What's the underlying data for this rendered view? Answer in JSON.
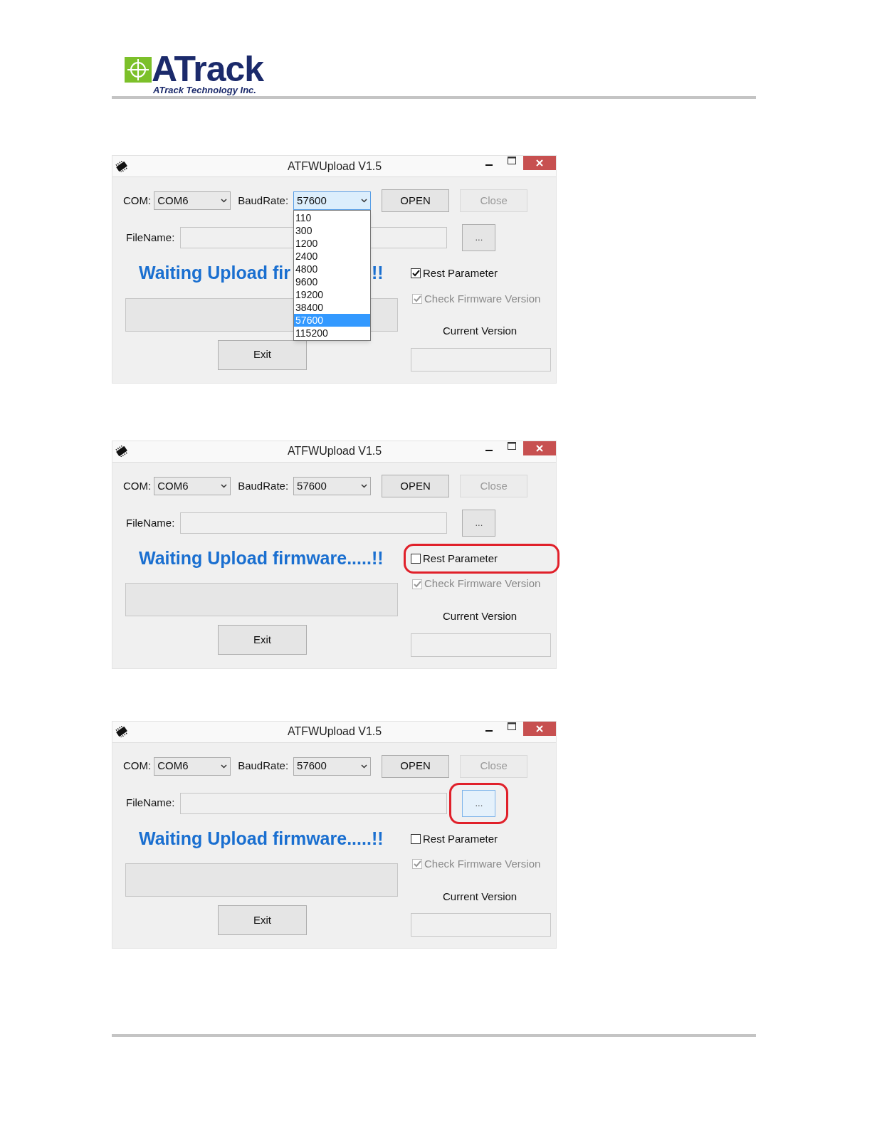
{
  "header": {
    "logo_name": "ATrack",
    "logo_tagline": "ATrack Technology Inc."
  },
  "windows": [
    {
      "title": "ATFWUpload V1.5",
      "com_label": "COM:",
      "com_value": "COM6",
      "baud_label": "BaudRate:",
      "baud_value": "57600",
      "baud_open": true,
      "baud_options": [
        {
          "label": "110",
          "selected": false
        },
        {
          "label": "300",
          "selected": false
        },
        {
          "label": "1200",
          "selected": false
        },
        {
          "label": "2400",
          "selected": false
        },
        {
          "label": "4800",
          "selected": false
        },
        {
          "label": "9600",
          "selected": false
        },
        {
          "label": "19200",
          "selected": false
        },
        {
          "label": "38400",
          "selected": false
        },
        {
          "label": "57600",
          "selected": true
        },
        {
          "label": "115200",
          "selected": false
        }
      ],
      "open_button": "OPEN",
      "close_button": {
        "label": "Close",
        "disabled": true
      },
      "filename_label": "FileName:",
      "browse_button": {
        "label": "...",
        "hovered": false,
        "highlighted": false
      },
      "status": "Waiting Upload fir",
      "status_after_list": "!!",
      "rest": {
        "label": "Rest Parameter",
        "checked": true,
        "highlighted": false
      },
      "check_fw": {
        "label": "Check Firmware Version",
        "checked": true,
        "disabled": true
      },
      "current_version_label": "Current Version",
      "exit_button": "Exit"
    },
    {
      "title": "ATFWUpload V1.5",
      "com_label": "COM:",
      "com_value": "COM6",
      "baud_label": "BaudRate:",
      "baud_value": "57600",
      "baud_open": false,
      "open_button": "OPEN",
      "close_button": {
        "label": "Close",
        "disabled": true
      },
      "filename_label": "FileName:",
      "browse_button": {
        "label": "...",
        "hovered": false,
        "highlighted": false
      },
      "status": "Waiting Upload firmware.....!!",
      "rest": {
        "label": "Rest Parameter",
        "checked": false,
        "highlighted": true
      },
      "check_fw": {
        "label": "Check Firmware Version",
        "checked": true,
        "disabled": true
      },
      "current_version_label": "Current Version",
      "exit_button": "Exit"
    },
    {
      "title": "ATFWUpload V1.5",
      "com_label": "COM:",
      "com_value": "COM6",
      "baud_label": "BaudRate:",
      "baud_value": "57600",
      "baud_open": false,
      "open_button": "OPEN",
      "close_button": {
        "label": "Close",
        "disabled": true
      },
      "filename_label": "FileName:",
      "browse_button": {
        "label": "...",
        "hovered": true,
        "highlighted": true
      },
      "status": "Waiting Upload firmware.....!!",
      "rest": {
        "label": "Rest Parameter",
        "checked": false,
        "highlighted": false
      },
      "check_fw": {
        "label": "Check Firmware Version",
        "checked": true,
        "disabled": true
      },
      "current_version_label": "Current Version",
      "exit_button": "Exit"
    }
  ]
}
